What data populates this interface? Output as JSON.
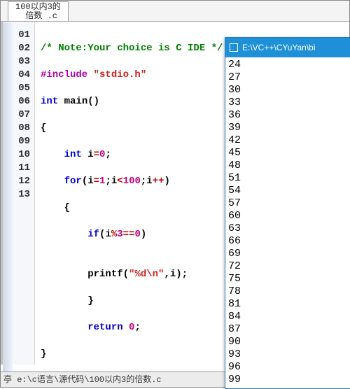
{
  "tab": {
    "label": "100以内3的\n  倍数 .c"
  },
  "lines": [
    "01",
    "02",
    "03",
    "04",
    "05",
    "06",
    "07",
    "08",
    "09",
    "10",
    "11",
    "12",
    "13"
  ],
  "code": {
    "l1": {
      "comment": "/* Note:Your choice is C IDE */"
    },
    "l2": {
      "pre": "#include ",
      "str": "\"stdio.h\""
    },
    "l3": {
      "kw1": "int",
      "sp1": " ",
      "id": "main",
      "paren": "()"
    },
    "l4": {
      "brace": "{"
    },
    "l5": {
      "indent": "    ",
      "kw": "int",
      "sp": " ",
      "id": "i",
      "op": "=",
      "num": "0",
      "semi": ";"
    },
    "l6": {
      "indent": "    ",
      "kw": "for",
      "open": "(",
      "id1": "i",
      "op1": "=",
      "n1": "1",
      "semi1": ";",
      "id2": "i",
      "op2": "<",
      "n2": "100",
      "semi2": ";",
      "id3": "i",
      "op3": "++",
      "close": ")"
    },
    "l7": {
      "indent": "    ",
      "brace": "{"
    },
    "l8": {
      "indent": "        ",
      "kw": "if",
      "open": "(",
      "id": "i",
      "op1": "%",
      "n1": "3",
      "op2": "==",
      "n2": "0",
      "close": ")"
    },
    "l10": {
      "indent": "        ",
      "id": "printf",
      "open": "(",
      "str": "\"%d\\n\"",
      "comma": ",",
      "arg": "i",
      "close": ")",
      "semi": ";"
    },
    "l11": {
      "indent": "        ",
      "brace": "}"
    },
    "l12": {
      "indent": "        ",
      "kw": "return",
      "sp": " ",
      "num": "0",
      "semi": ";"
    },
    "l13": {
      "brace": "}"
    }
  },
  "status": {
    "text": "亭 e:\\c语言\\源代码\\100以内3的倍数.c"
  },
  "output_window": {
    "title": "E:\\VC++\\CYuYan\\bi",
    "rows": [
      "24",
      "27",
      "30",
      "33",
      "36",
      "39",
      "42",
      "45",
      "48",
      "51",
      "54",
      "57",
      "60",
      "63",
      "66",
      "69",
      "72",
      "75",
      "78",
      "81",
      "84",
      "87",
      "90",
      "93",
      "96",
      "99"
    ]
  }
}
